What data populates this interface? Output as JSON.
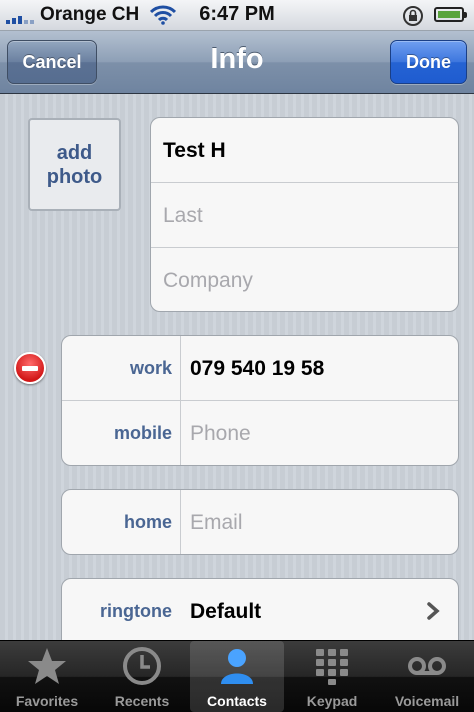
{
  "status": {
    "carrier": "Orange CH",
    "time": "6:47 PM"
  },
  "nav": {
    "title": "Info",
    "cancel": "Cancel",
    "done": "Done"
  },
  "photo": {
    "label_line1": "add",
    "label_line2": "photo"
  },
  "name_fields": {
    "first_value": "Test H",
    "last_placeholder": "Last",
    "company_placeholder": "Company"
  },
  "phone_fields": [
    {
      "label": "work",
      "value": "079 540 19 58"
    },
    {
      "label": "mobile",
      "placeholder": "Phone"
    }
  ],
  "email_field": {
    "label": "home",
    "placeholder": "Email"
  },
  "ringtone": {
    "label": "ringtone",
    "value": "Default"
  },
  "tabs": [
    {
      "label": "Favorites",
      "icon": "star-icon"
    },
    {
      "label": "Recents",
      "icon": "clock-icon"
    },
    {
      "label": "Contacts",
      "icon": "contacts-icon",
      "active": true
    },
    {
      "label": "Keypad",
      "icon": "keypad-icon"
    },
    {
      "label": "Voicemail",
      "icon": "voicemail-icon"
    }
  ],
  "colors": {
    "label_blue": "#4a6693",
    "done_blue": "#2563d3",
    "delete_red": "#d21818"
  }
}
